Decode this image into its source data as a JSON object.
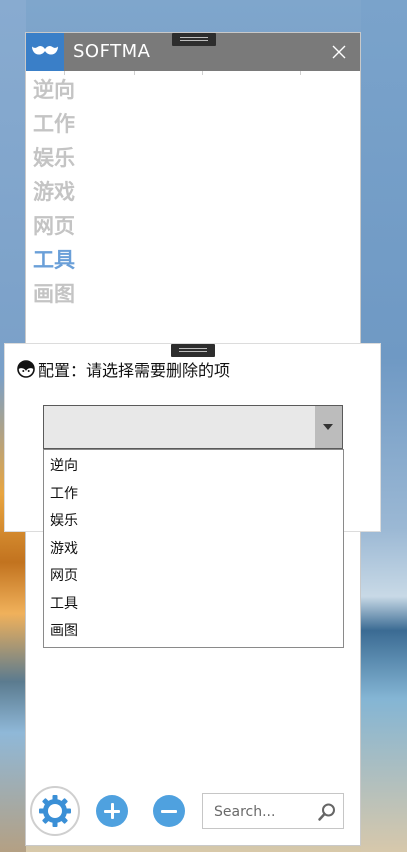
{
  "app": {
    "title": "SOFTMA"
  },
  "categories": [
    {
      "label": "逆向",
      "active": false
    },
    {
      "label": "工作",
      "active": false
    },
    {
      "label": "娱乐",
      "active": false
    },
    {
      "label": "游戏",
      "active": false
    },
    {
      "label": "网页",
      "active": false
    },
    {
      "label": "工具",
      "active": true
    },
    {
      "label": "画图",
      "active": false
    }
  ],
  "dialog": {
    "title": "配置：请选择需要删除的项",
    "selected_value": "",
    "options": [
      "逆向",
      "工作",
      "娱乐",
      "游戏",
      "网页",
      "工具",
      "画图"
    ]
  },
  "toolbar": {
    "search_placeholder": "Search...",
    "icons": [
      "gear-icon",
      "plus-icon",
      "minus-icon",
      "search-icon"
    ]
  },
  "colors": {
    "titlebar": "#7a7a7a",
    "logo_bg": "#3a7fc8",
    "active_category": "#6a9fd8",
    "inactive_category": "#c4c4c4",
    "accent_button": "#4fa1df"
  }
}
